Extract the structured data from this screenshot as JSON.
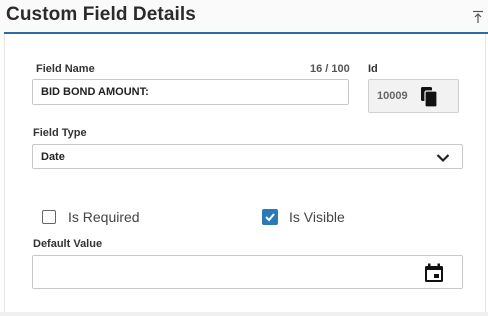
{
  "panel": {
    "title": "Custom Field Details",
    "collapse_icon": "collapse-up-icon"
  },
  "field_name": {
    "label": "Field Name",
    "counter": "16 / 100",
    "value": "BID BOND AMOUNT:"
  },
  "id": {
    "label": "Id",
    "value": "10009",
    "copy_icon": "copy-icon"
  },
  "field_type": {
    "label": "Field Type",
    "value": "Date",
    "dropdown_icon": "chevron-down-icon"
  },
  "is_required": {
    "label": "Is Required",
    "checked": false
  },
  "is_visible": {
    "label": "Is Visible",
    "checked": true
  },
  "default_value": {
    "label": "Default Value",
    "value": "",
    "calendar_icon": "calendar-icon"
  },
  "colors": {
    "accent": "#2d6ca2",
    "checkbox_checked": "#2a7ab8"
  }
}
